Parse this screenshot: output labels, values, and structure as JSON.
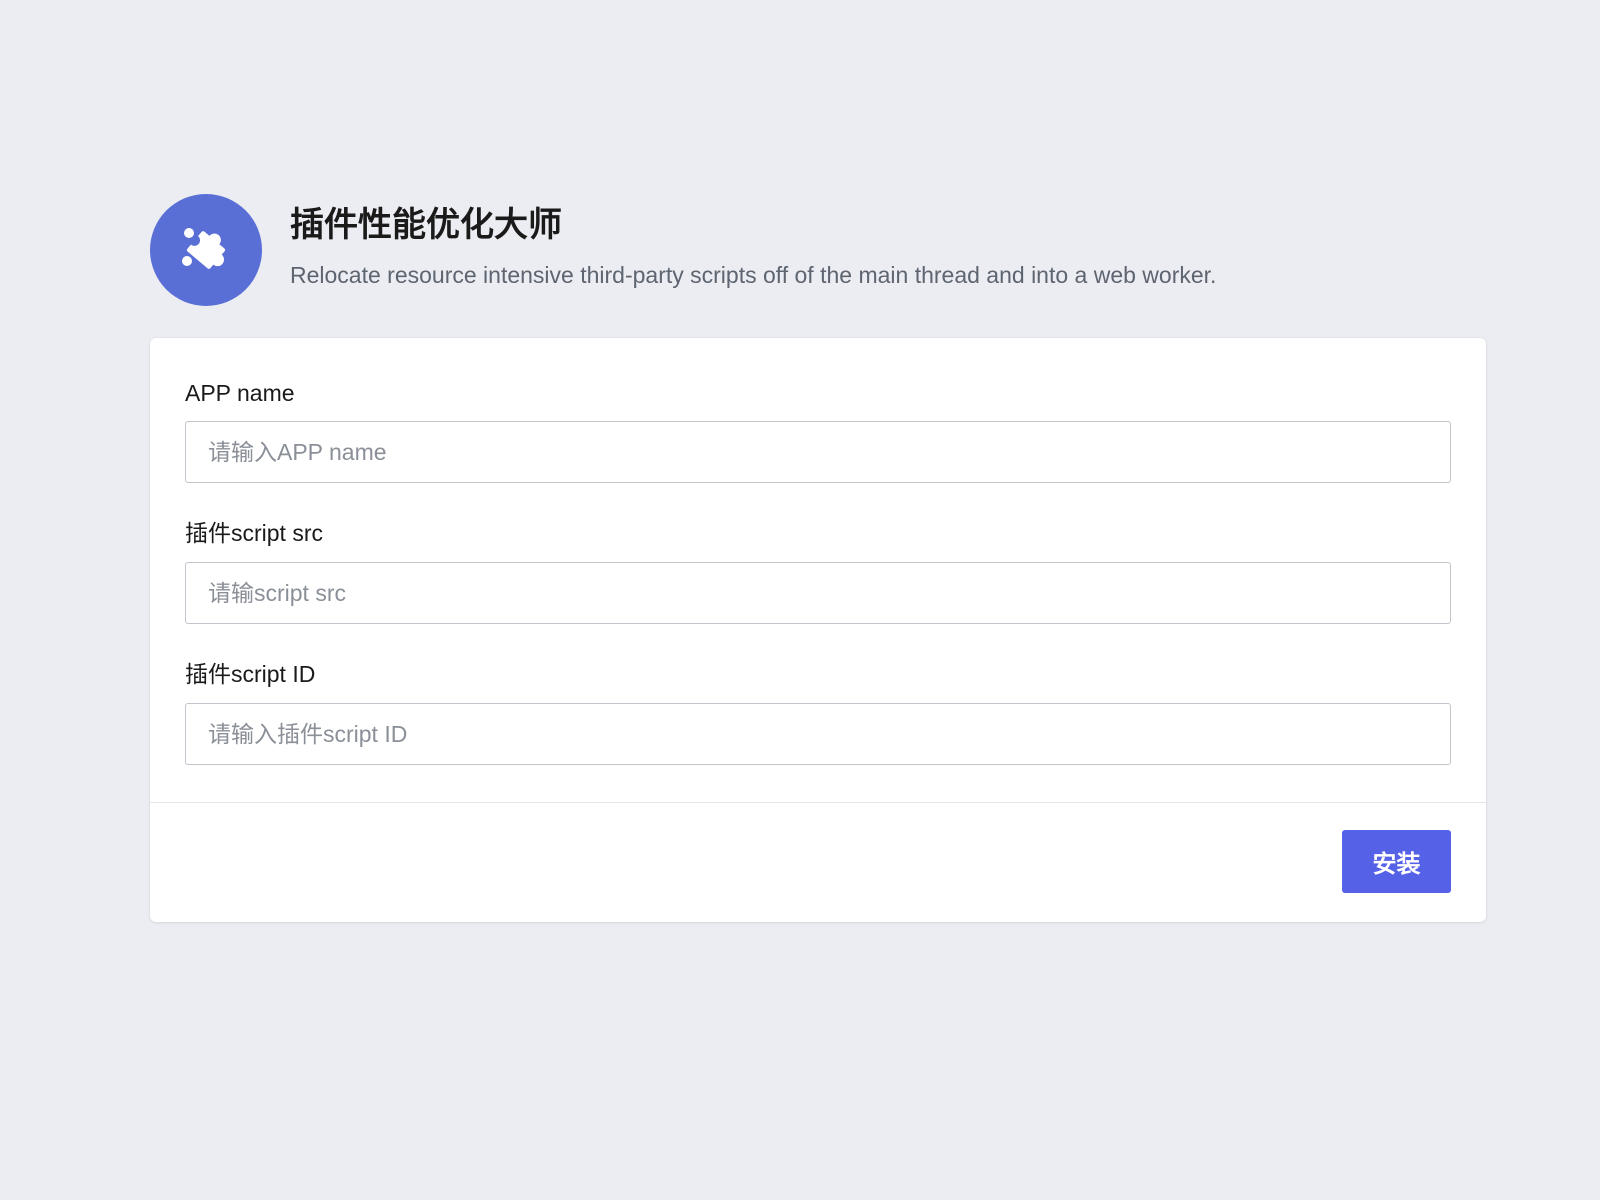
{
  "header": {
    "logo_icon": "puzzle-piece-icon",
    "title": "插件性能优化大师",
    "subtitle": "Relocate resource intensive third-party scripts off of the main thread and into a web worker."
  },
  "form": {
    "fields": [
      {
        "label": "APP name",
        "value": "",
        "placeholder": "请输入APP name"
      },
      {
        "label": "插件script src",
        "value": "",
        "placeholder": "请输script src"
      },
      {
        "label": "插件script ID",
        "value": "",
        "placeholder": "请输入插件script ID"
      }
    ]
  },
  "footer": {
    "install_label": "安装"
  },
  "colors": {
    "background": "#ebedf2",
    "logo": "#5a6fd6",
    "button": "#5561e6"
  }
}
